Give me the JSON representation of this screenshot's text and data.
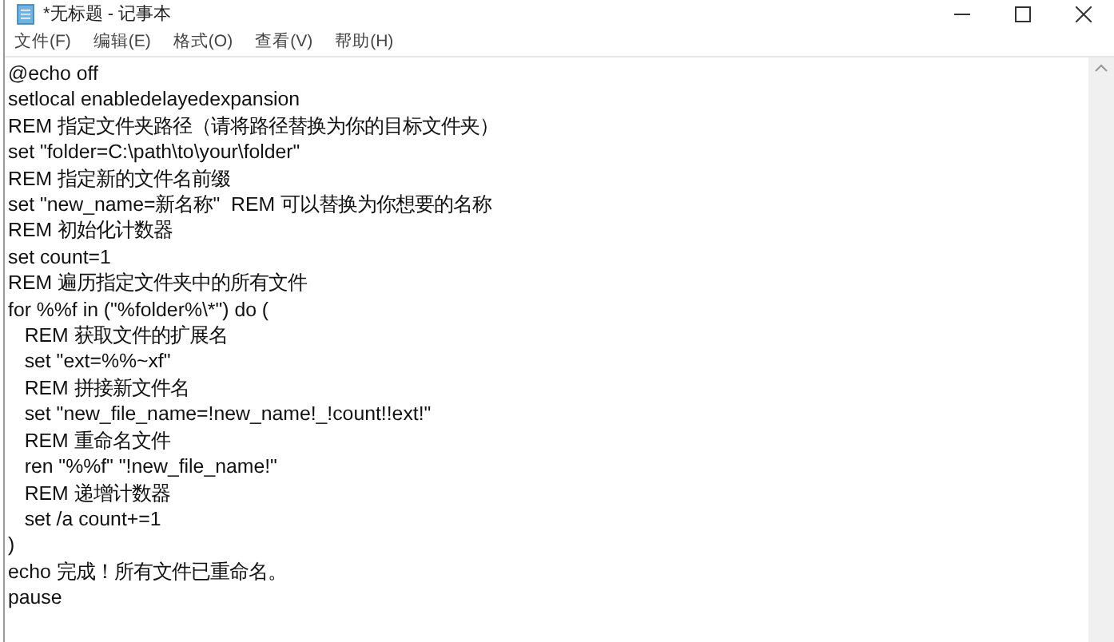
{
  "window": {
    "title": "*无标题 - 记事本"
  },
  "menu": [
    "文件(F)",
    "编辑(E)",
    "格式(O)",
    "查看(V)",
    "帮助(H)"
  ],
  "lines": [
    "@echo off",
    "setlocal enabledelayedexpansion",
    "REM 指定文件夹路径（请将路径替换为你的目标文件夹）",
    "set \"folder=C:\\path\\to\\your\\folder\"",
    "REM 指定新的文件名前缀",
    "set \"new_name=新名称\"  REM 可以替换为你想要的名称",
    "REM 初始化计数器",
    "set count=1",
    "REM 遍历指定文件夹中的所有文件",
    "for %%f in (\"%folder%\\*\") do (",
    "   REM 获取文件的扩展名",
    "   set \"ext=%%~xf\"",
    "   REM 拼接新文件名",
    "   set \"new_file_name=!new_name!_!count!!ext!\"",
    "   REM 重命名文件",
    "   ren \"%%f\" \"!new_file_name!\"",
    "   REM 递增计数器",
    "   set /a count+=1",
    ")",
    "echo 完成！所有文件已重命名。",
    "pause"
  ]
}
